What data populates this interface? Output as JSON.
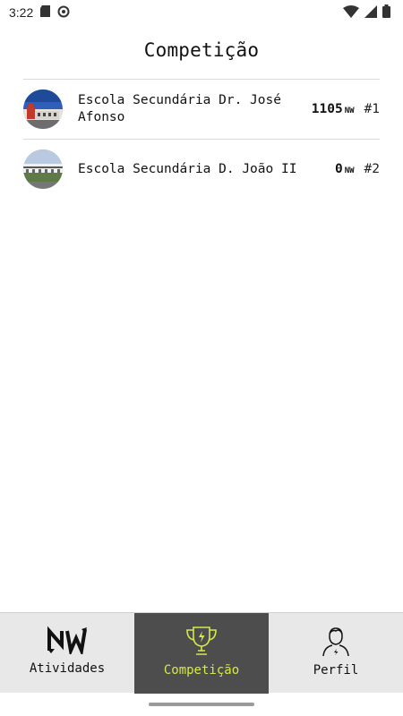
{
  "status_bar": {
    "time": "3:22",
    "left_icons": [
      "sd-card-icon",
      "sync-icon"
    ],
    "right_icons": [
      "wifi-icon",
      "signal-icon",
      "battery-icon"
    ]
  },
  "header": {
    "title": "Competição"
  },
  "competition": {
    "schools": [
      {
        "name": "Escola Secundária Dr. José Afonso",
        "points": "1105",
        "unit": "NW",
        "rank": "#1",
        "avatar": "school-photo-1"
      },
      {
        "name": "Escola Secundária D. João II",
        "points": "0",
        "unit": "NW",
        "rank": "#2",
        "avatar": "school-photo-2"
      }
    ]
  },
  "bottom_nav": {
    "active_tab": "competicao",
    "tabs": [
      {
        "id": "atividades",
        "label": "Atividades",
        "icon": "nw-logo-icon"
      },
      {
        "id": "competicao",
        "label": "Competição",
        "icon": "trophy-icon"
      },
      {
        "id": "perfil",
        "label": "Perfil",
        "icon": "person-icon"
      }
    ]
  },
  "colors": {
    "active_tab_bg": "#4d4d4d",
    "active_tab_accent": "#d7e84a",
    "nav_bg": "#e8e8e8"
  }
}
